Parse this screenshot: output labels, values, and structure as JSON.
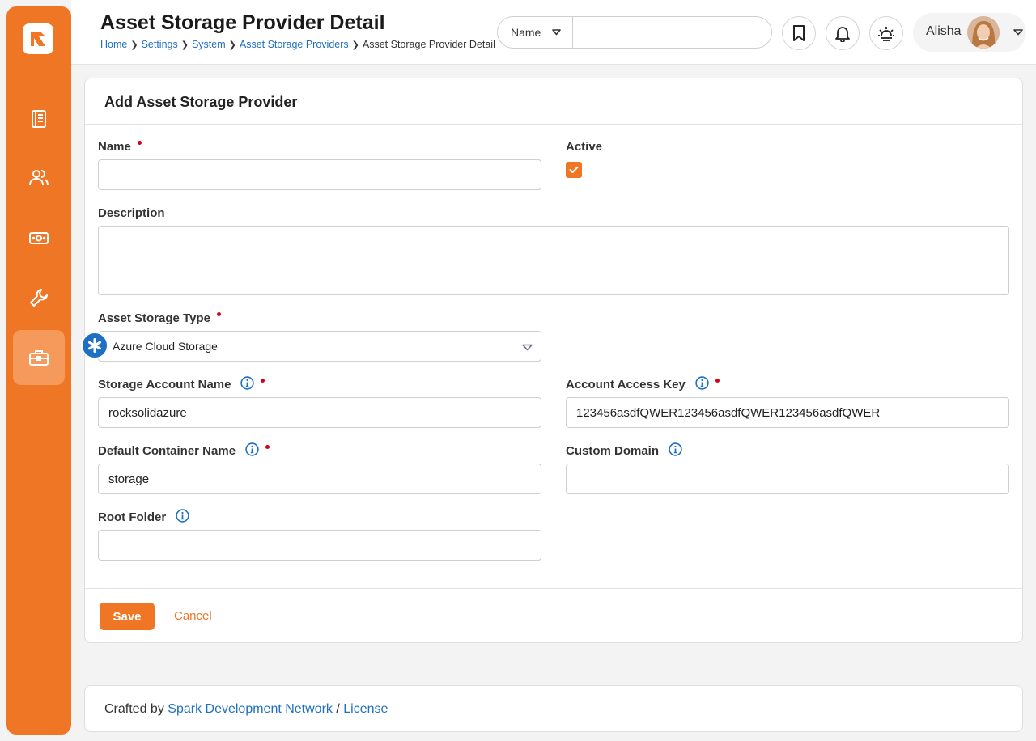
{
  "header": {
    "title": "Asset Storage Provider Detail",
    "breadcrumb": [
      "Home",
      "Settings",
      "System",
      "Asset Storage Providers"
    ],
    "breadcrumb_current": "Asset Storage Provider Detail",
    "search_filter": "Name",
    "search_value": "",
    "user_name": "Alisha"
  },
  "sidebar": {
    "items": [
      "notebook-icon",
      "people-icon",
      "money-icon",
      "wrench-icon",
      "briefcase-icon"
    ],
    "active": "briefcase-icon"
  },
  "form": {
    "card_title": "Add Asset Storage Provider",
    "name_label": "Name",
    "name_value": "",
    "active_label": "Active",
    "active_checked": true,
    "description_label": "Description",
    "description_value": "",
    "storage_type_label": "Asset Storage Type",
    "storage_type_value": "Azure Cloud Storage",
    "account_name_label": "Storage Account Name",
    "account_name_value": "rocksolidazure",
    "access_key_label": "Account Access Key",
    "access_key_value": "123456asdfQWER123456asdfQWER123456asdfQWER",
    "container_label": "Default Container Name",
    "container_value": "storage",
    "custom_domain_label": "Custom Domain",
    "custom_domain_value": "",
    "root_folder_label": "Root Folder",
    "root_folder_value": "",
    "save_label": "Save",
    "cancel_label": "Cancel"
  },
  "footer": {
    "prefix": "Crafted by",
    "org_link": "Spark Development Network",
    "separator": "/",
    "license_link": "License"
  },
  "colors": {
    "accent": "#ee7625",
    "link": "#1f6fc2",
    "required": "#d0021b"
  }
}
